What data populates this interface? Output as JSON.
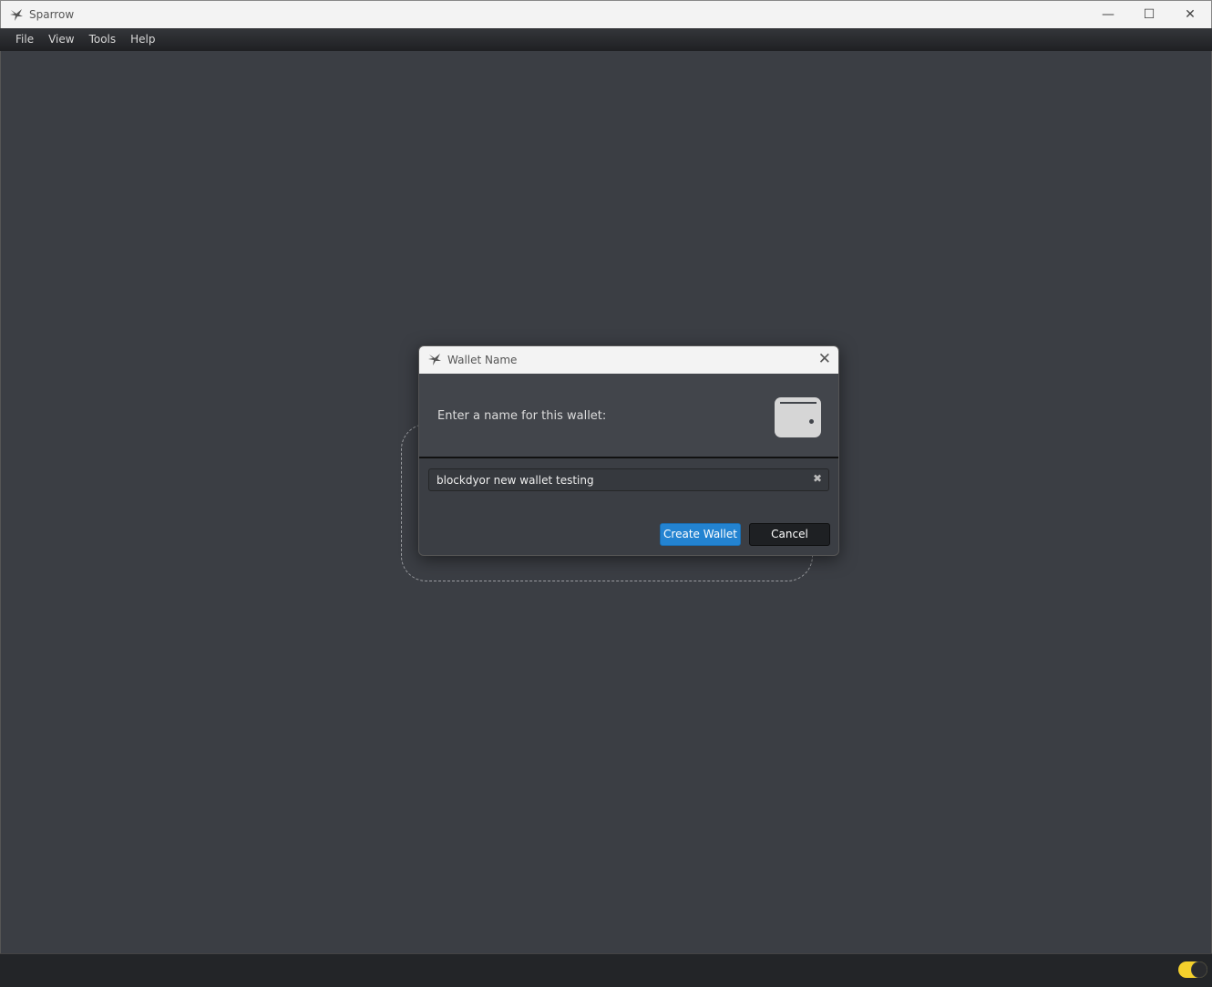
{
  "window": {
    "title": "Sparrow",
    "minimize_icon": "minimize-icon",
    "maximize_icon": "maximize-icon",
    "close_icon": "close-icon"
  },
  "menu": [
    "File",
    "View",
    "Tools",
    "Help"
  ],
  "dialog": {
    "title": "Wallet Name",
    "prompt": "Enter a name for this wallet:",
    "icon": "wallet-icon",
    "input_value": "blockdyor new wallet testing",
    "create_label": "Create Wallet",
    "cancel_label": "Cancel"
  },
  "status": {
    "theme_toggle_on": true
  },
  "colors": {
    "accent": "#2383d1",
    "toggle": "#f4d02c",
    "background": "#3b3e44"
  }
}
